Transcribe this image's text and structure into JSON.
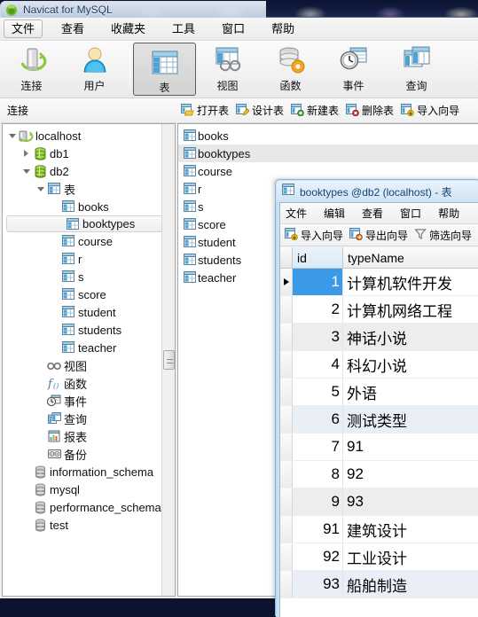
{
  "window": {
    "title": "Navicat for MySQL",
    "app_icon": "navicat-logo-icon"
  },
  "menubar": {
    "items": [
      {
        "label": "文件",
        "active": true
      },
      {
        "label": "查看",
        "active": false
      },
      {
        "label": "收藏夹",
        "active": false
      },
      {
        "label": "工具",
        "active": false
      },
      {
        "label": "窗口",
        "active": false
      },
      {
        "label": "帮助",
        "active": false
      }
    ]
  },
  "toolbar": {
    "buttons": [
      {
        "label": "连接",
        "icon": "connection-icon",
        "selected": false
      },
      {
        "label": "用户",
        "icon": "user-icon",
        "selected": false
      },
      {
        "label": "表",
        "icon": "table-icon",
        "selected": true
      },
      {
        "label": "视图",
        "icon": "view-icon",
        "selected": false
      },
      {
        "label": "函数",
        "icon": "function-icon",
        "selected": false
      },
      {
        "label": "事件",
        "icon": "event-icon",
        "selected": false
      },
      {
        "label": "查询",
        "icon": "query-icon",
        "selected": false
      }
    ]
  },
  "subbar": {
    "connection_label": "连接",
    "actions": [
      {
        "label": "打开表",
        "icon": "open-table-icon"
      },
      {
        "label": "设计表",
        "icon": "design-table-icon"
      },
      {
        "label": "新建表",
        "icon": "new-table-icon"
      },
      {
        "label": "删除表",
        "icon": "delete-table-icon"
      },
      {
        "label": "导入向导",
        "icon": "import-wizard-icon"
      }
    ]
  },
  "tree": {
    "nodes": [
      {
        "label": "localhost",
        "icon": "server-icon",
        "indent": 0,
        "twist": "open",
        "selected": false
      },
      {
        "label": "db1",
        "icon": "database-icon",
        "indent": 1,
        "twist": "closed",
        "selected": false
      },
      {
        "label": "db2",
        "icon": "database-icon",
        "indent": 1,
        "twist": "open",
        "selected": false
      },
      {
        "label": "表",
        "icon": "table-folder-icon",
        "indent": 2,
        "twist": "open",
        "selected": false
      },
      {
        "label": "books",
        "icon": "table-icon",
        "indent": 3,
        "twist": "none",
        "selected": false
      },
      {
        "label": "booktypes",
        "icon": "table-icon",
        "indent": 3,
        "twist": "none",
        "selected": true
      },
      {
        "label": "course",
        "icon": "table-icon",
        "indent": 3,
        "twist": "none",
        "selected": false
      },
      {
        "label": "r",
        "icon": "table-icon",
        "indent": 3,
        "twist": "none",
        "selected": false
      },
      {
        "label": "s",
        "icon": "table-icon",
        "indent": 3,
        "twist": "none",
        "selected": false
      },
      {
        "label": "score",
        "icon": "table-icon",
        "indent": 3,
        "twist": "none",
        "selected": false
      },
      {
        "label": "student",
        "icon": "table-icon",
        "indent": 3,
        "twist": "none",
        "selected": false
      },
      {
        "label": "students",
        "icon": "table-icon",
        "indent": 3,
        "twist": "none",
        "selected": false
      },
      {
        "label": "teacher",
        "icon": "table-icon",
        "indent": 3,
        "twist": "none",
        "selected": false
      },
      {
        "label": "视图",
        "icon": "view-folder-icon",
        "indent": 2,
        "twist": "none",
        "selected": false
      },
      {
        "label": "函数",
        "icon": "function-folder-icon",
        "indent": 2,
        "twist": "none",
        "selected": false
      },
      {
        "label": "事件",
        "icon": "event-folder-icon",
        "indent": 2,
        "twist": "none",
        "selected": false
      },
      {
        "label": "查询",
        "icon": "query-folder-icon",
        "indent": 2,
        "twist": "none",
        "selected": false
      },
      {
        "label": "报表",
        "icon": "report-folder-icon",
        "indent": 2,
        "twist": "none",
        "selected": false
      },
      {
        "label": "备份",
        "icon": "backup-folder-icon",
        "indent": 2,
        "twist": "none",
        "selected": false
      },
      {
        "label": "information_schema",
        "icon": "database-gray-icon",
        "indent": 1,
        "twist": "none",
        "selected": false
      },
      {
        "label": "mysql",
        "icon": "database-gray-icon",
        "indent": 1,
        "twist": "none",
        "selected": false
      },
      {
        "label": "performance_schema",
        "icon": "database-gray-icon",
        "indent": 1,
        "twist": "none",
        "selected": false
      },
      {
        "label": "test",
        "icon": "database-gray-icon",
        "indent": 1,
        "twist": "none",
        "selected": false
      }
    ]
  },
  "objectlist": {
    "items": [
      {
        "label": "books",
        "selected": false
      },
      {
        "label": "booktypes",
        "selected": true
      },
      {
        "label": "course",
        "selected": false
      },
      {
        "label": "r",
        "selected": false
      },
      {
        "label": "s",
        "selected": false
      },
      {
        "label": "score",
        "selected": false
      },
      {
        "label": "student",
        "selected": false
      },
      {
        "label": "students",
        "selected": false
      },
      {
        "label": "teacher",
        "selected": false
      }
    ]
  },
  "child_window": {
    "title": "booktypes @db2 (localhost) - 表",
    "icon": "table-icon",
    "menus": [
      {
        "label": "文件"
      },
      {
        "label": "编辑"
      },
      {
        "label": "查看"
      },
      {
        "label": "窗口"
      },
      {
        "label": "帮助"
      }
    ],
    "toolbar": [
      {
        "label": "导入向导",
        "icon": "import-wizard-icon"
      },
      {
        "label": "导出向导",
        "icon": "export-wizard-icon"
      },
      {
        "label": "筛选向导",
        "icon": "filter-wizard-icon"
      }
    ],
    "grid": {
      "columns": [
        "id",
        "typeName"
      ],
      "active_column": "id",
      "current_row_index": 0,
      "rows": [
        {
          "id": "1",
          "typeName": "计算机软件开发",
          "tint": "none",
          "current": true
        },
        {
          "id": "2",
          "typeName": "计算机网络工程",
          "tint": "none",
          "current": false
        },
        {
          "id": "3",
          "typeName": "神话小说",
          "tint": "gray",
          "current": false
        },
        {
          "id": "4",
          "typeName": "科幻小说",
          "tint": "none",
          "current": false
        },
        {
          "id": "5",
          "typeName": "外语",
          "tint": "none",
          "current": false
        },
        {
          "id": "6",
          "typeName": "测试类型",
          "tint": "blue",
          "current": false
        },
        {
          "id": "7",
          "typeName": "91",
          "tint": "none",
          "current": false
        },
        {
          "id": "8",
          "typeName": "92",
          "tint": "none",
          "current": false
        },
        {
          "id": "9",
          "typeName": "93",
          "tint": "gray",
          "current": false
        },
        {
          "id": "91",
          "typeName": "建筑设计",
          "tint": "none",
          "current": false
        },
        {
          "id": "92",
          "typeName": "工业设计",
          "tint": "none",
          "current": false
        },
        {
          "id": "93",
          "typeName": "船舶制造",
          "tint": "blue",
          "current": false
        }
      ]
    }
  },
  "colors": {
    "selection_blue": "#3a9ae8",
    "row_tint_blue": "#eaeff7",
    "row_tint_gray": "#ededed",
    "child_frame": "#86b4da",
    "window_chrome": "#f0f0f0"
  }
}
